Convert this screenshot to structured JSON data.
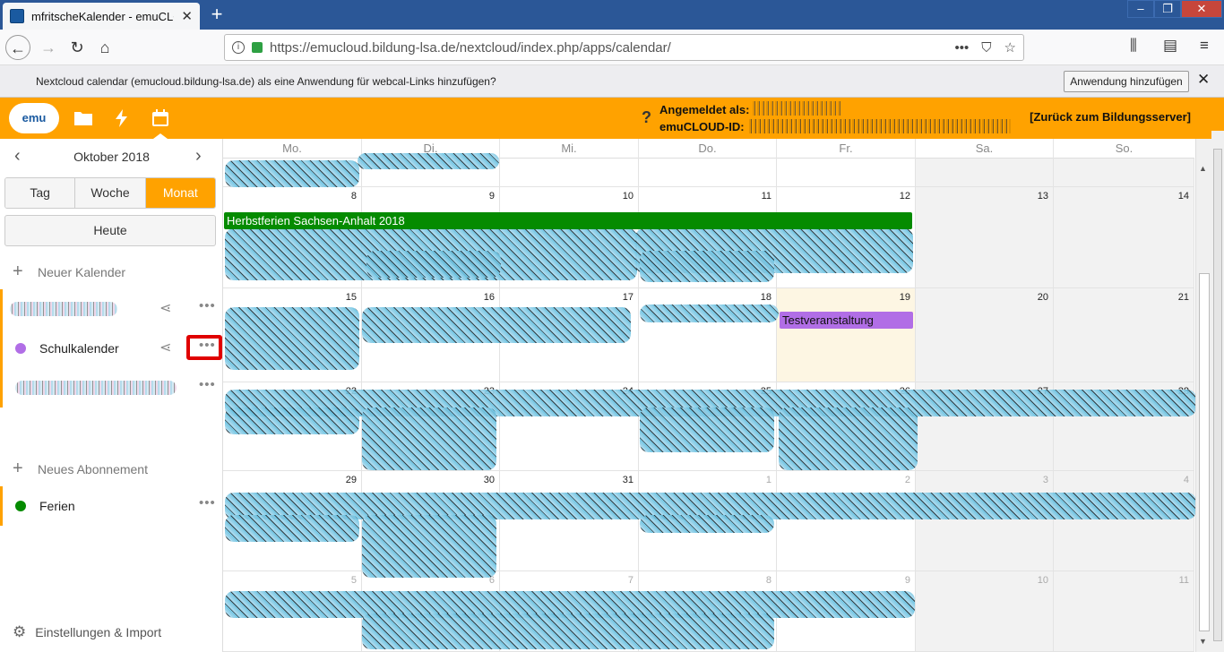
{
  "browser": {
    "tab_title": "mfritscheKalender - emuCLOUD",
    "url": "https://emucloud.bildung-lsa.de/nextcloud/index.php/apps/calendar/",
    "url_actions": "•••"
  },
  "notification": {
    "message": "Nextcloud calendar (emucloud.bildung-lsa.de) als eine Anwendung für webcal-Links hinzufügen?",
    "button": "Anwendung hinzufügen",
    "close": "✕"
  },
  "header": {
    "help": "?",
    "logged_in_label": "Angemeldet als:",
    "id_label": "emuCLOUD-ID:",
    "back_link": "[Zurück zum Bildungsserver]",
    "logo_text": "emu"
  },
  "sidebar": {
    "month_title": "Oktober 2018",
    "views": [
      "Tag",
      "Woche",
      "Monat"
    ],
    "today": "Heute",
    "new_calendar": "Neuer Kalender",
    "calendars": [
      {
        "name": "",
        "color": "#c5d97a"
      },
      {
        "name": "Schulkalender",
        "color": "#b16ee6"
      },
      {
        "name": "",
        "color": "#e1b7d9"
      }
    ],
    "new_subscription": "Neues Abonnement",
    "subscriptions": [
      {
        "name": "Ferien",
        "color": "#058b00"
      }
    ],
    "settings": "Einstellungen & Import"
  },
  "calendar": {
    "day_headers": [
      "Mo.",
      "Di.",
      "Mi.",
      "Do.",
      "Fr.",
      "Sa.",
      "So."
    ],
    "weeks": [
      [
        "",
        "",
        "",
        "",
        "",
        "",
        ""
      ],
      [
        "8",
        "9",
        "10",
        "11",
        "12",
        "13",
        "14"
      ],
      [
        "15",
        "16",
        "17",
        "18",
        "19",
        "20",
        "21"
      ],
      [
        "22",
        "23",
        "24",
        "25",
        "26",
        "27",
        "28"
      ],
      [
        "29",
        "30",
        "31",
        "1",
        "2",
        "3",
        "4"
      ],
      [
        "5",
        "6",
        "7",
        "8",
        "9",
        "10",
        "11"
      ]
    ],
    "events": {
      "herbstferien": "Herbstferien Sachsen-Anhalt 2018",
      "testveranstaltung": "Testveranstaltung"
    },
    "colors": {
      "ferien": "#058b00",
      "schulkalender": "#b16ee6",
      "accent": "#ffa200"
    }
  }
}
